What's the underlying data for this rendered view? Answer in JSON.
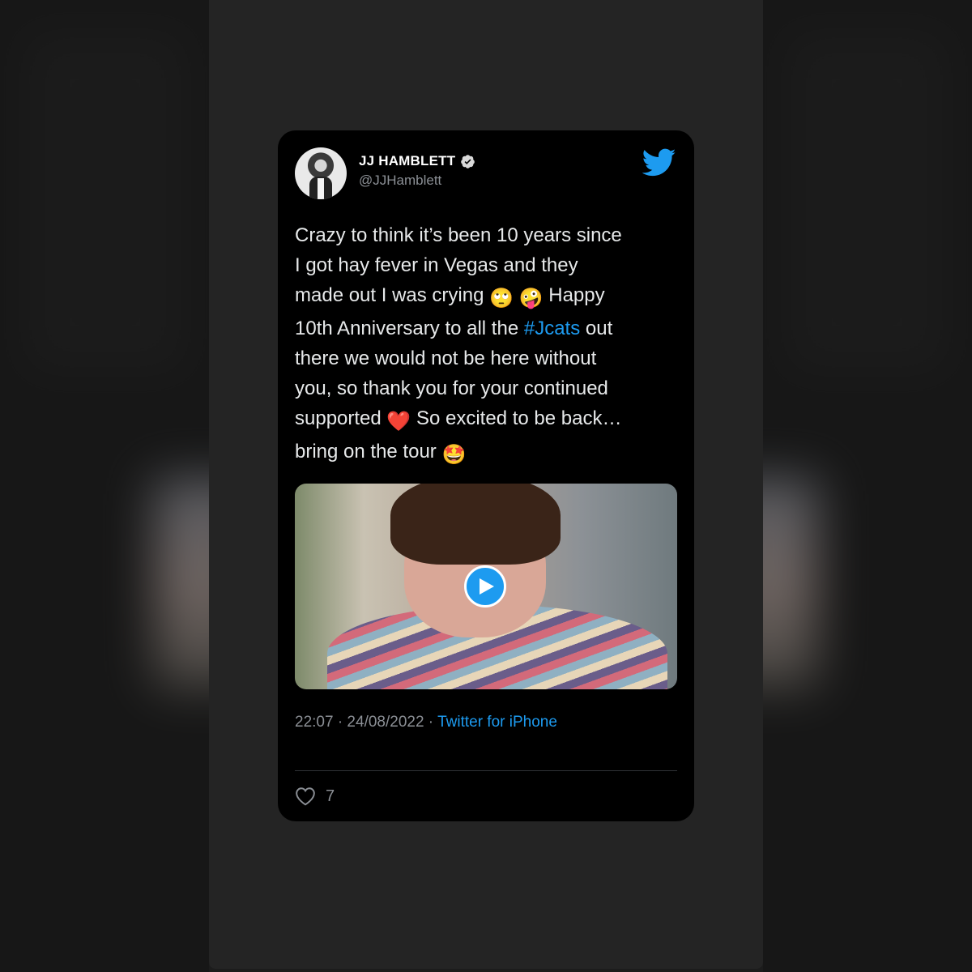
{
  "tweet": {
    "display_name": "JJ HAMBLETT",
    "handle": "@JJHamblett",
    "text_part1": "Crazy to think it’s been 10 years since\nI got hay fever in Vegas and they\nmade out I was crying ",
    "emoji_roll": "🙄",
    "emoji_zany": "🤪",
    "text_part2": " Happy\n10th Anniversary to all the ",
    "hashtag": "#Jcats",
    "text_part3": " out\nthere we would not be here without\nyou, so thank you for your continued\nsupported ",
    "emoji_heart": "❤️",
    "text_part4": " So excited to be back…\nbring on the tour ",
    "emoji_star": "🤩",
    "timestamp": "22:07 · 24/08/2022 · ",
    "source": "Twitter for iPhone",
    "like_count": "7"
  },
  "icons": {
    "verified": "verified-badge-icon",
    "logo": "twitter-bird-icon",
    "play": "play-icon",
    "like": "heart-icon"
  },
  "colors": {
    "accent": "#1d9bf0",
    "card_bg": "#000000",
    "text": "#e7e9ea",
    "muted": "#8b8f95"
  }
}
